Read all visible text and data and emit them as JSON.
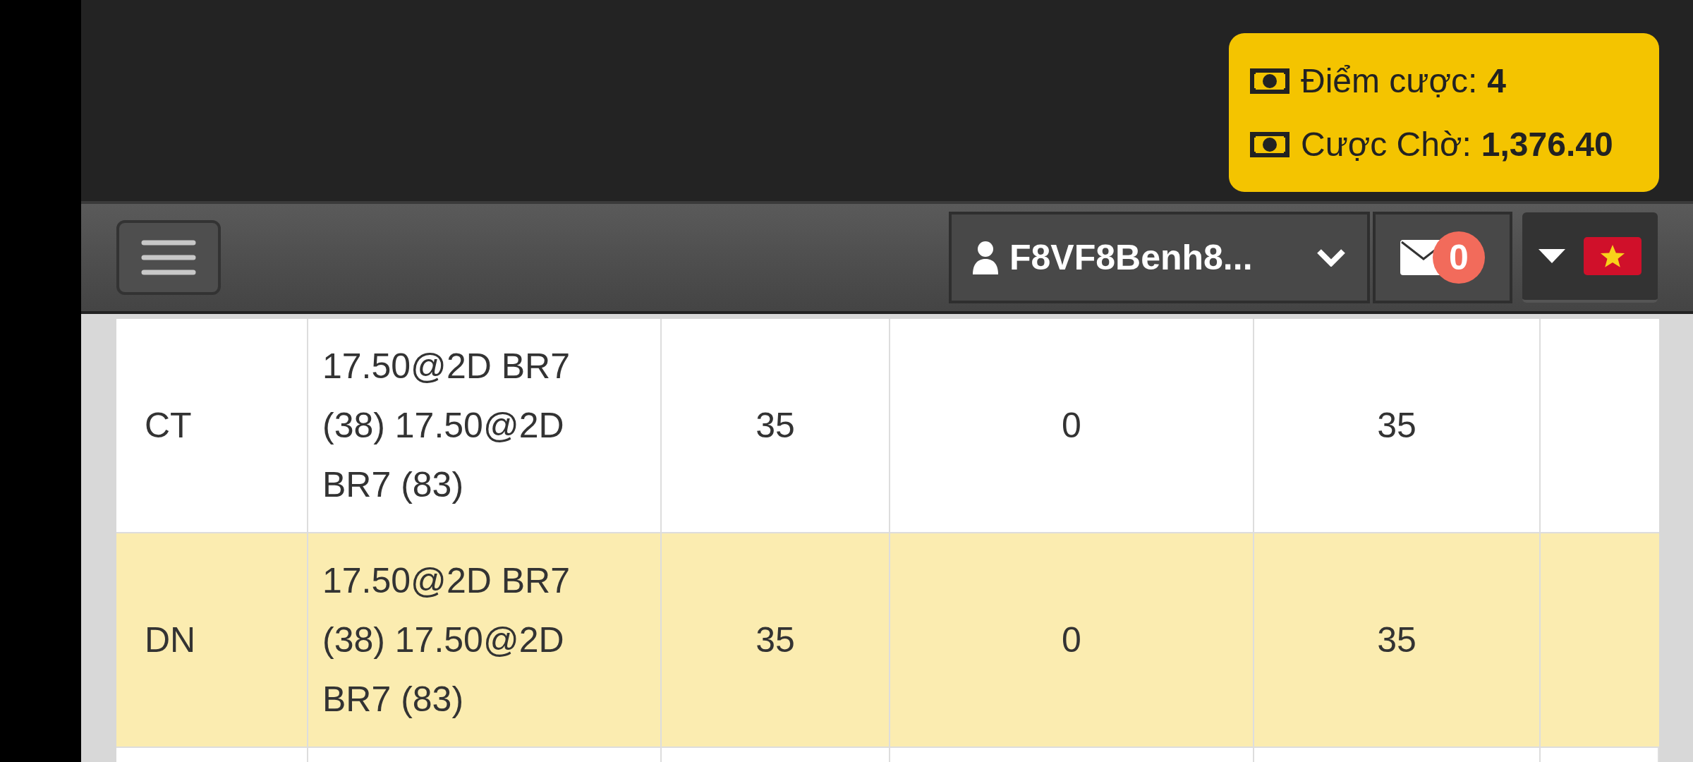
{
  "balance": {
    "lines": [
      {
        "label": "Điểm cược:",
        "value": "4"
      },
      {
        "label": "Cược Chờ:",
        "value": "1,376.40"
      }
    ]
  },
  "navbar": {
    "username": "F8VF8Benh8...",
    "message_count": "0"
  },
  "table": {
    "rows": [
      {
        "highlighted": false,
        "cells": [
          "CT",
          "17.50@2D BR7 (38) 17.50@2D BR7 (83)",
          "35",
          "0",
          "35"
        ]
      },
      {
        "highlighted": true,
        "cells": [
          "DN",
          "17.50@2D BR7 (38) 17.50@2D BR7 (83)",
          "35",
          "0",
          "35"
        ]
      }
    ]
  }
}
